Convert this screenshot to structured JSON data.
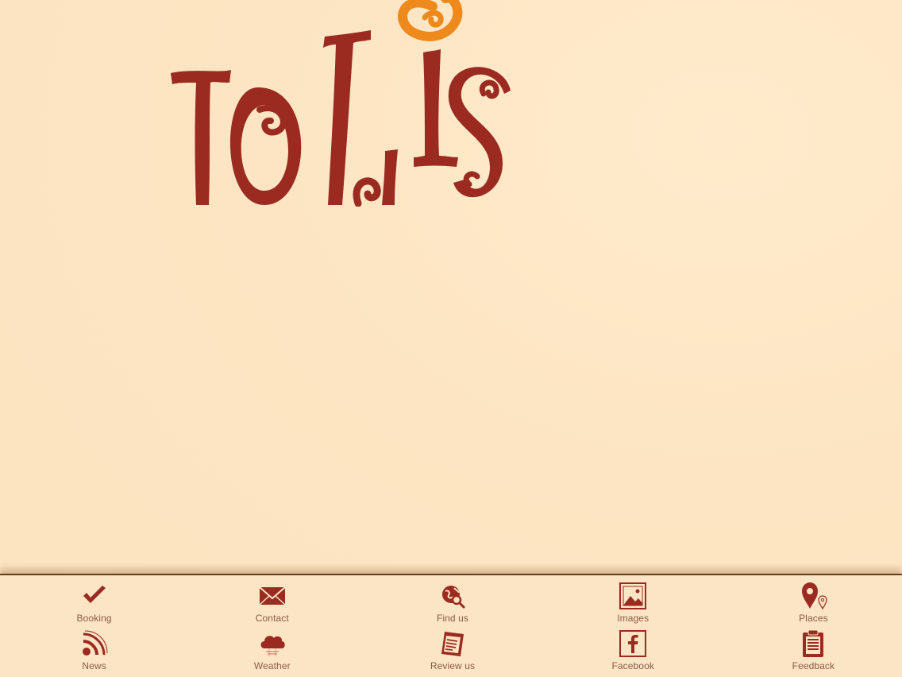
{
  "app": {
    "name": "Tollis",
    "logo_text": "TOLLIS"
  },
  "colors": {
    "background": "#FDE6C5",
    "brand_red": "#9B2A20",
    "brand_orange": "#EE8A1C",
    "label_text": "#8A5A45"
  },
  "tabbar": {
    "items": [
      {
        "label": "Booking",
        "icon": "checkmark-icon"
      },
      {
        "label": "Contact",
        "icon": "envelope-icon"
      },
      {
        "label": "Find us",
        "icon": "globe-search-icon"
      },
      {
        "label": "Images",
        "icon": "picture-icon"
      },
      {
        "label": "Places",
        "icon": "map-pin-icon"
      },
      {
        "label": "News",
        "icon": "rss-icon"
      },
      {
        "label": "Weather",
        "icon": "cloud-icon"
      },
      {
        "label": "Review us",
        "icon": "review-icon"
      },
      {
        "label": "Facebook",
        "icon": "facebook-icon"
      },
      {
        "label": "Feedback",
        "icon": "clipboard-icon"
      }
    ]
  }
}
